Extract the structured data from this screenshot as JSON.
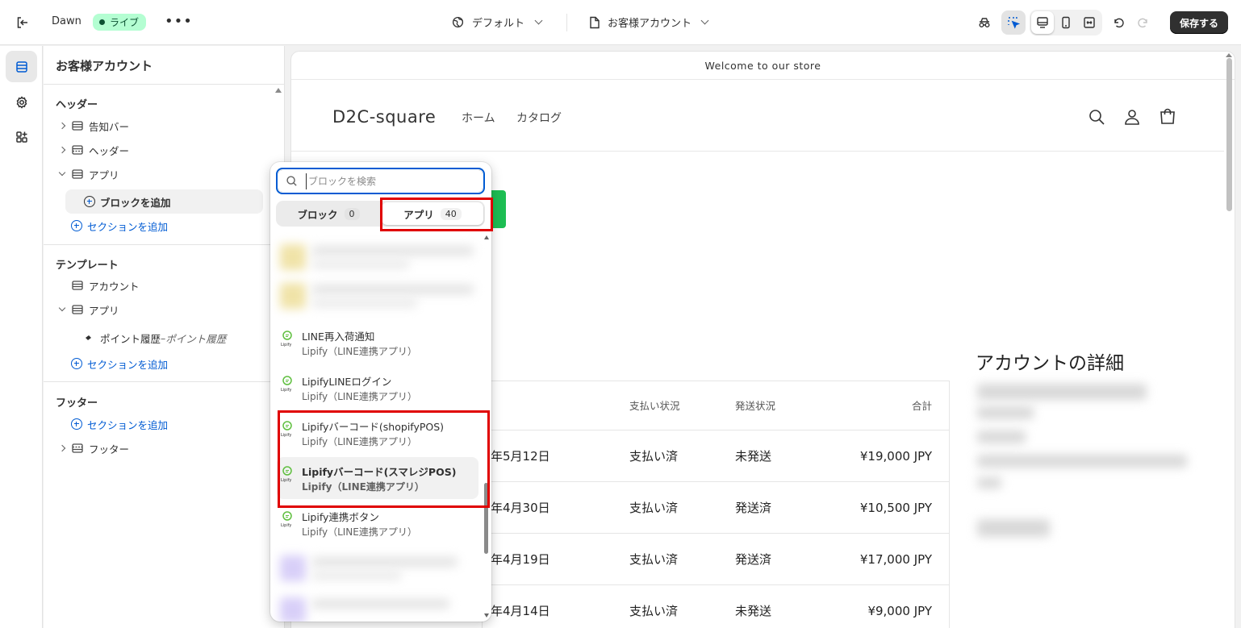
{
  "topbar": {
    "theme_name": "Dawn",
    "live_label": "ライブ",
    "more_label": "•••",
    "template_selector": "デフォルト",
    "page_selector": "お客様アカウント",
    "save_label": "保存する"
  },
  "sidebar": {
    "title": "お客様アカウント",
    "header_section": {
      "label": "ヘッダー",
      "items": [
        {
          "label": "告知バー"
        },
        {
          "label": "ヘッダー"
        },
        {
          "label": "アプリ"
        }
      ],
      "add_block": "ブロックを追加",
      "add_section": "セクションを追加"
    },
    "template_section": {
      "label": "テンプレート",
      "items": [
        {
          "label": "アカウント"
        },
        {
          "label": "アプリ"
        }
      ],
      "app_block_name": "ポイント履歴",
      "app_block_sep": " – ",
      "app_block_sub": "ポイント履歴",
      "add_section": "セクションを追加"
    },
    "footer_section": {
      "label": "フッター",
      "add_section": "セクションを追加",
      "items": [
        {
          "label": "フッター"
        }
      ]
    }
  },
  "preview": {
    "announcement": "Welcome to our store",
    "brand": "D2C-square",
    "nav": [
      "ホーム",
      "カタログ"
    ],
    "account_title": "アカウントの詳細",
    "orders": {
      "headers": {
        "payment": "支払い状況",
        "fulfillment": "発送状況",
        "total": "合計"
      },
      "rows": [
        {
          "date": "年5月12日",
          "payment": "支払い済",
          "fulfillment": "未発送",
          "total": "¥19,000 JPY"
        },
        {
          "date": "年4月30日",
          "payment": "支払い済",
          "fulfillment": "発送済",
          "total": "¥10,500 JPY"
        },
        {
          "date": "年4月19日",
          "payment": "支払い済",
          "fulfillment": "発送済",
          "total": "¥17,000 JPY"
        },
        {
          "date": "年4月14日",
          "payment": "支払い済",
          "fulfillment": "未発送",
          "total": "¥9,000 JPY"
        }
      ]
    }
  },
  "popup": {
    "search_placeholder": "ブロックを検索",
    "tabs": [
      {
        "label": "ブロック",
        "count": "0"
      },
      {
        "label": "アプリ",
        "count": "40"
      }
    ],
    "apps": [
      {
        "name": "LINE再入荷通知",
        "sub": "Lipify（LINE連携アプリ）"
      },
      {
        "name": "LipifyLINEログイン",
        "sub": "Lipify（LINE連携アプリ）"
      },
      {
        "name": "Lipifyバーコード(shopifyPOS)",
        "sub": "Lipify（LINE連携アプリ）"
      },
      {
        "name": "Lipifyバーコード(スマレジPOS)",
        "sub": "Lipify（LINE連携アプリ）"
      },
      {
        "name": "Lipify連携ボタン",
        "sub": "Lipify（LINE連携アプリ）"
      }
    ],
    "logo_text": "Lipify"
  },
  "colors": {
    "accent": "#005bd3",
    "live_bg": "#b4fed2",
    "highlight": "#e00000",
    "save_bg": "#303030",
    "cta_green": "#1dbe53"
  }
}
